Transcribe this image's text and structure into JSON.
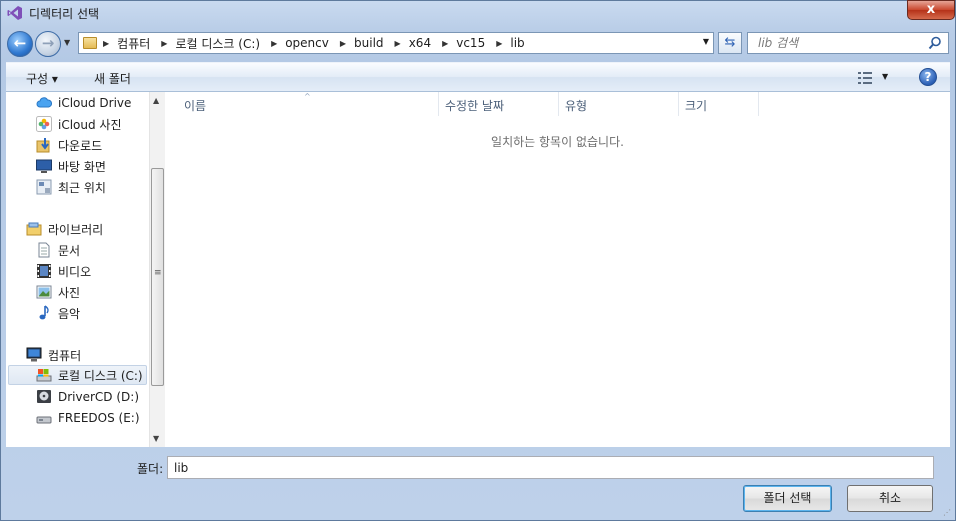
{
  "window": {
    "title": "디렉터리 선택",
    "close_label": "x"
  },
  "address_bar": {
    "breadcrumbs": [
      "컴퓨터",
      "로컬 디스크 (C:)",
      "opencv",
      "build",
      "x64",
      "vc15",
      "lib"
    ],
    "search_placeholder": "lib 검색"
  },
  "toolbar": {
    "organize_label": "구성 ▾",
    "new_folder_label": "새 폴더",
    "help_label": "?"
  },
  "nav_pane": {
    "favorites": [
      {
        "label": "iCloud Drive",
        "icon": "icloud-drive-icon"
      },
      {
        "label": "iCloud 사진",
        "icon": "icloud-photos-icon"
      },
      {
        "label": "다운로드",
        "icon": "downloads-icon"
      },
      {
        "label": "바탕 화면",
        "icon": "desktop-icon"
      },
      {
        "label": "최근 위치",
        "icon": "recent-places-icon"
      }
    ],
    "libraries_header": "라이브러리",
    "libraries": [
      {
        "label": "문서",
        "icon": "documents-icon"
      },
      {
        "label": "비디오",
        "icon": "videos-icon"
      },
      {
        "label": "사진",
        "icon": "pictures-icon"
      },
      {
        "label": "음악",
        "icon": "music-icon"
      }
    ],
    "computer_header": "컴퓨터",
    "drives": [
      {
        "label": "로컬 디스크 (C:)",
        "icon": "local-disk-icon",
        "selected": true
      },
      {
        "label": "DriverCD (D:)",
        "icon": "cd-drive-icon",
        "selected": false
      },
      {
        "label": "FREEDOS (E:)",
        "icon": "removable-drive-icon",
        "selected": false
      }
    ]
  },
  "file_list": {
    "columns": [
      "이름",
      "수정한 날짜",
      "유형",
      "크기"
    ],
    "empty_message": "일치하는 항목이 없습니다."
  },
  "footer": {
    "folder_label": "폴더:",
    "folder_value": "lib",
    "select_button": "폴더 선택",
    "cancel_button": "취소"
  },
  "colors": {
    "accent": "#2f78d0",
    "frame": "#b4c9e5",
    "close": "#c9462c"
  }
}
